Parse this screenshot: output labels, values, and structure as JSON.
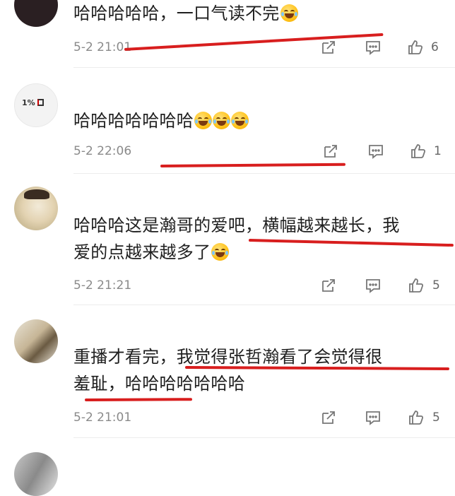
{
  "comments": [
    {
      "text": "哈哈哈哈哈，一口气读不完",
      "emojis": [
        "grin-sweat-emoji"
      ],
      "date": "5-2 21:01",
      "likes": "6"
    },
    {
      "avatar_text": "1%",
      "text": "哈哈哈哈哈哈哈",
      "emojis": [
        "grin-sweat-emoji",
        "grin-sweat-emoji",
        "grin-sweat-emoji"
      ],
      "date": "5-2 22:06",
      "likes": "1"
    },
    {
      "text_line1": "哈哈哈这是瀚哥的爱吧，横幅越来越长，我",
      "text_line2": "爱的点越来越多了",
      "emojis": [
        "grin-sweat-emoji"
      ],
      "date": "5-2 21:21",
      "likes": "5"
    },
    {
      "text_line1": "重播才看完，我觉得张哲瀚看了会觉得很",
      "text_line2": "羞耻，哈哈哈哈哈哈哈",
      "date": "5-2 21:01",
      "likes": "5"
    }
  ],
  "icons": {
    "share": "share-icon",
    "reply": "comment-icon",
    "like": "thumbs-up-icon"
  },
  "colors": {
    "annotation_red": "#d81e1e",
    "meta_gray": "#8a8a8a"
  }
}
